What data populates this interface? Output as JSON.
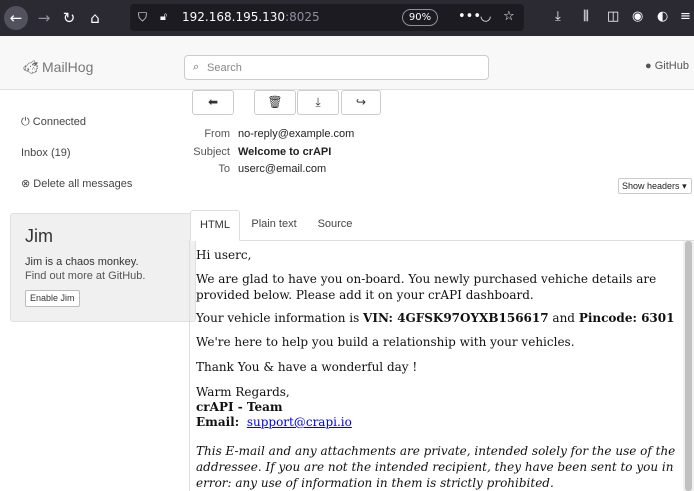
{
  "browser": {
    "url_host": "192.168.195.130",
    "url_port": ":8025",
    "zoom": "90%"
  },
  "app": {
    "name": "MailHog",
    "github_label": "GitHub"
  },
  "search": {
    "placeholder": "Search"
  },
  "sidebar": {
    "connected": "Connected",
    "inbox": "Inbox (19)",
    "delete_all": "Delete all messages",
    "jim": {
      "title": "Jim",
      "description": "Jim is a chaos monkey.",
      "more": "Find out more at GitHub.",
      "enable_label": "Enable Jim"
    }
  },
  "message": {
    "from_label": "From",
    "from": "no-reply@example.com",
    "subject_label": "Subject",
    "subject": "Welcome to crAPI",
    "to_label": "To",
    "to": "userc@email.com",
    "show_headers": "Show headers"
  },
  "tabs": [
    "HTML",
    "Plain text",
    "Source"
  ],
  "body": {
    "greeting": "Hi userc,",
    "para1": "We are glad to have you on-board. You newly purchased vehiche details are provided below. Please add it on your crAPI dashboard.",
    "vehicle_prefix": "Your vehicle information is ",
    "vin_label": "VIN: 4GFSK97OYXB156617",
    "vehicle_and": " and ",
    "pincode_label": "Pincode: 6301",
    "para3": "We're here to help you build a relationship with your vehicles.",
    "para4": "Thank You & have a wonderful day !",
    "regards": "Warm Regards,",
    "team": "crAPI - Team",
    "email_label": "Email:",
    "email_link": "support@crapi.io",
    "disclaimer": "This E-mail and any attachments are private, intended solely for the use of the addressee. If you are not the intended recipient, they have been sent to you in error: any use of information in them is strictly prohibited."
  }
}
